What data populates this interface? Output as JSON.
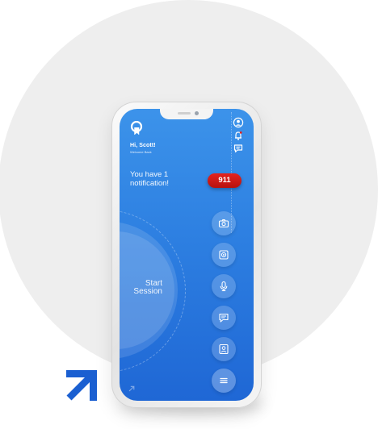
{
  "header": {
    "greeting": "Hi, Scott!",
    "greeting_sub": "Welcome Back",
    "icons": [
      "user-icon",
      "bell-icon",
      "chat-icon"
    ]
  },
  "notification": {
    "text": "You have 1 notification!",
    "badge": "911",
    "badge_color": "#d11a17"
  },
  "session": {
    "label": "Start Session"
  },
  "actions": [
    {
      "name": "camera-icon"
    },
    {
      "name": "video-icon"
    },
    {
      "name": "microphone-icon"
    },
    {
      "name": "message-icon"
    },
    {
      "name": "contact-icon"
    },
    {
      "name": "menu-icon"
    }
  ],
  "colors": {
    "screen_top": "#3c93ea",
    "screen_bottom": "#1f67d5",
    "brand_arrow": "#1a5fd1",
    "background_circle": "#eeeeee"
  }
}
